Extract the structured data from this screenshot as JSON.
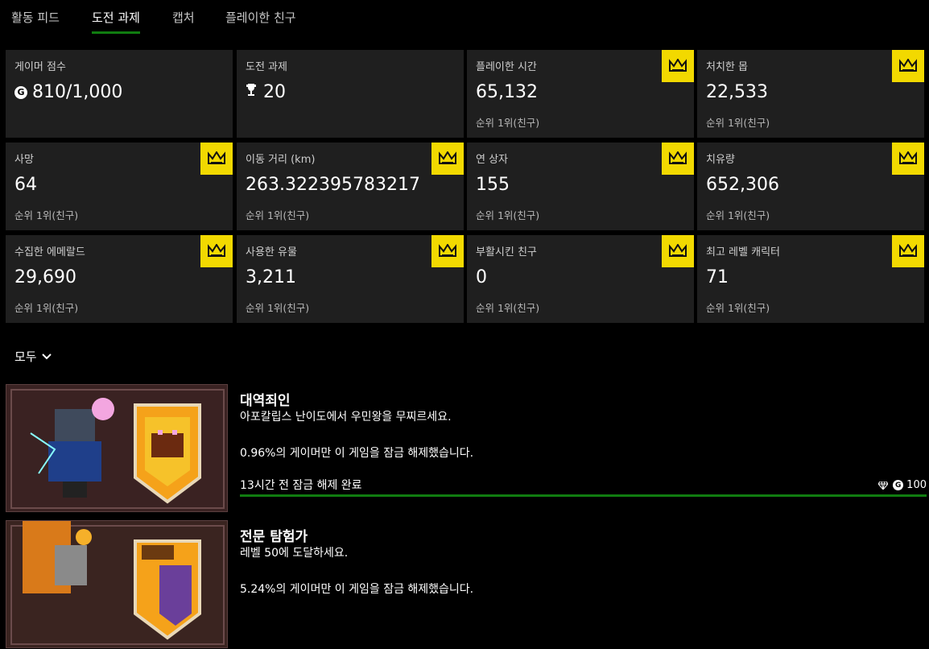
{
  "tabs": [
    {
      "label": "활동 피드",
      "active": false
    },
    {
      "label": "도전 과제",
      "active": true
    },
    {
      "label": "캡처",
      "active": false
    },
    {
      "label": "플레이한 친구",
      "active": false
    }
  ],
  "stats": [
    {
      "label": "게이머 점수",
      "value": "810/1,000",
      "rank": "",
      "icon": "gamerscore-icon",
      "crown": false
    },
    {
      "label": "도전 과제",
      "value": "20",
      "rank": "",
      "icon": "trophy-icon",
      "crown": false
    },
    {
      "label": "플레이한 시간",
      "value": "65,132",
      "rank": "순위 1위(친구)",
      "crown": true
    },
    {
      "label": "처치한 몹",
      "value": "22,533",
      "rank": "순위 1위(친구)",
      "crown": true
    },
    {
      "label": "사망",
      "value": "64",
      "rank": "순위 1위(친구)",
      "crown": true
    },
    {
      "label": "이동 거리 (km)",
      "value": "263.322395783217",
      "rank": "순위 1위(친구)",
      "crown": true
    },
    {
      "label": "연 상자",
      "value": "155",
      "rank": "순위 1위(친구)",
      "crown": true
    },
    {
      "label": "치유량",
      "value": "652,306",
      "rank": "순위 1위(친구)",
      "crown": true
    },
    {
      "label": "수집한 에메랄드",
      "value": "29,690",
      "rank": "순위 1위(친구)",
      "crown": true
    },
    {
      "label": "사용한 유물",
      "value": "3,211",
      "rank": "순위 1위(친구)",
      "crown": true
    },
    {
      "label": "부활시킨 친구",
      "value": "0",
      "rank": "순위 1위(친구)",
      "crown": true
    },
    {
      "label": "최고 레벨 캐릭터",
      "value": "71",
      "rank": "순위 1위(친구)",
      "crown": true
    }
  ],
  "filter": {
    "label": "모두"
  },
  "achievements": [
    {
      "title": "대역죄인",
      "description": "아포칼립스 난이도에서 우민왕을 무찌르세요.",
      "rarity": "0.96%의 게이머만 이 게임을 잠금 해제했습니다.",
      "unlocked": "13시간 전 잠금 해제 완료",
      "reward": "100",
      "progress": 1.0
    },
    {
      "title": "전문 탐험가",
      "description": "레벨 50에 도달하세요.",
      "rarity": "5.24%의 게이머만 이 게임을 잠금 해제했습니다.",
      "unlocked": "",
      "reward": "",
      "progress": 1.0
    }
  ],
  "colors": {
    "accent": "#107c10",
    "crown_bg": "#f2d900",
    "card_bg": "#1f1f1f"
  }
}
